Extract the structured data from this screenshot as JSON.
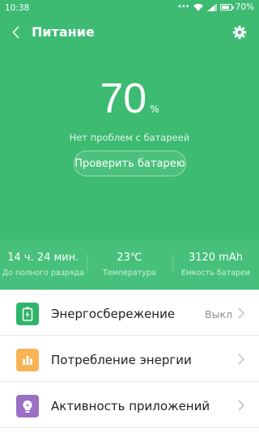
{
  "status_bar": {
    "time": "10:38",
    "battery_percent": "70%",
    "battery_level": 0.7
  },
  "app_bar": {
    "title": "Питание",
    "back_icon": "chevron-left-icon",
    "settings_icon": "gear-icon"
  },
  "battery": {
    "percent_value": "70",
    "percent_unit": "%",
    "status_text": "Нет проблем с батареей",
    "check_button_label": "Проверить батарею"
  },
  "stats": [
    {
      "value": "14 ч. 24 мин.",
      "label": "До полного разряда"
    },
    {
      "value": "23℃",
      "label": "Температура"
    },
    {
      "value": "3120 mAh",
      "label": "Емкость батареи"
    }
  ],
  "menu": [
    {
      "label": "Энергосбережение",
      "value": "Выкл",
      "icon": "battery-saver-icon",
      "color": "#2fb46b"
    },
    {
      "label": "Потребление энергии",
      "value": "",
      "icon": "bar-chart-icon",
      "color": "#f7b354"
    },
    {
      "label": "Активность приложений",
      "value": "",
      "icon": "lightbulb-icon",
      "color": "#9a6fc4"
    }
  ],
  "colors": {
    "primary_green": "#3dbb72",
    "stats_green": "#46c07a"
  }
}
